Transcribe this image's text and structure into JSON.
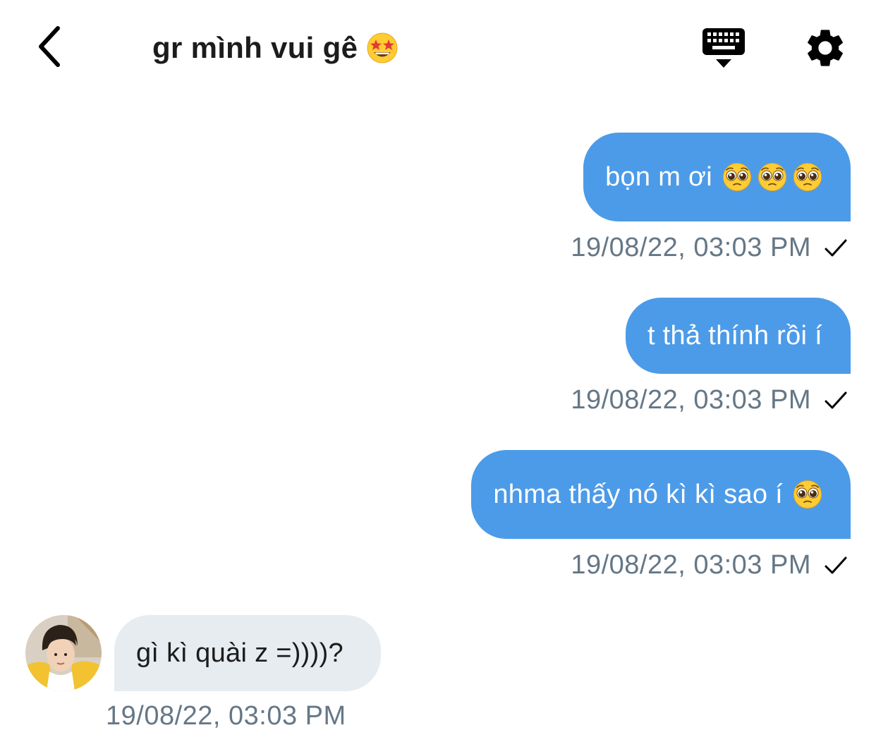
{
  "header": {
    "title": "gr mình vui gê",
    "title_emoji": "star-struck-emoji",
    "back_icon": "chevron-left-icon",
    "keyboard_icon": "keyboard-hide-icon",
    "settings_icon": "gear-icon"
  },
  "messages": [
    {
      "direction": "outgoing",
      "text": "bọn m ơi",
      "emojis": [
        "pleading-face-emoji",
        "pleading-face-emoji",
        "pleading-face-emoji"
      ],
      "timestamp": "19/08/22, 03:03 PM",
      "status": "sent"
    },
    {
      "direction": "outgoing",
      "text": "t thả thính rồi í",
      "emojis": [],
      "timestamp": "19/08/22, 03:03 PM",
      "status": "sent"
    },
    {
      "direction": "outgoing",
      "text": "nhma thấy nó kì kì sao í",
      "emojis": [
        "pleading-face-emoji"
      ],
      "timestamp": "19/08/22, 03:03 PM",
      "status": "sent"
    },
    {
      "direction": "incoming",
      "text": "gì kì quài z =))))?",
      "emojis": [],
      "timestamp": "19/08/22, 03:03 PM",
      "status": ""
    }
  ],
  "colors": {
    "outgoing_bubble": "#4c9be8",
    "incoming_bubble": "#e6ecf0",
    "timestamp": "#657786",
    "icon": "#000000"
  }
}
